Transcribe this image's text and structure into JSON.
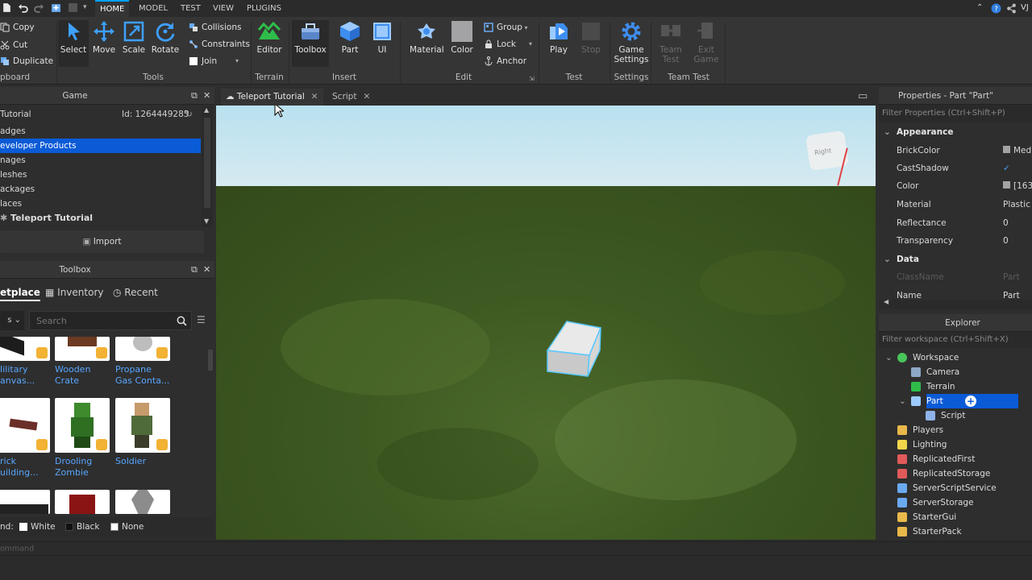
{
  "menubar": {
    "tabs": [
      "HOME",
      "MODEL",
      "TEST",
      "VIEW",
      "PLUGINS"
    ],
    "active_tab": "HOME",
    "user_initial": "VJ"
  },
  "ribbon": {
    "clipboard": {
      "copy": "Copy",
      "cut": "Cut",
      "duplicate": "Duplicate",
      "group_label": "pboard"
    },
    "tools": {
      "select": "Select",
      "move": "Move",
      "scale": "Scale",
      "rotate": "Rotate",
      "collisions": "Collisions",
      "constraints": "Constraints",
      "join": "Join",
      "group_label": "Tools"
    },
    "terrain": {
      "editor": "Editor",
      "group_label": "Terrain"
    },
    "insert": {
      "toolbox": "Toolbox",
      "part": "Part",
      "ui": "UI",
      "group_label": "Insert"
    },
    "edit": {
      "material": "Material",
      "color": "Color",
      "group": "Group",
      "lock": "Lock",
      "anchor": "Anchor",
      "group_label": "Edit"
    },
    "test": {
      "play": "Play",
      "stop": "Stop",
      "group_label": "Test"
    },
    "settings": {
      "game_settings_1": "Game",
      "game_settings_2": "Settings",
      "group_label": "Settings"
    },
    "team_test": {
      "team_test_1": "Team",
      "team_test_2": "Test",
      "exit_game_1": "Exit",
      "exit_game_2": "Game",
      "group_label": "Team Test"
    }
  },
  "game_panel": {
    "title": "Game",
    "place_name": "Tutorial",
    "place_id": "Id: 1264449285",
    "items": [
      "adges",
      "eveloper Products",
      "nages",
      "leshes",
      "ackages",
      "laces"
    ],
    "selected_index": 1,
    "place_entry": "Teleport Tutorial",
    "import_label": "Import"
  },
  "toolbox": {
    "title": "Toolbox",
    "tabs": [
      "etplace",
      "Inventory",
      "Recent"
    ],
    "search_placeholder": "Search",
    "items": [
      {
        "line1": "Iilitary",
        "line2": "anvas..."
      },
      {
        "line1": "Wooden",
        "line2": "Crate"
      },
      {
        "line1": "Propane",
        "line2": "Gas Conta..."
      },
      {
        "line1": "rick",
        "line2": "uilding..."
      },
      {
        "line1": "Drooling",
        "line2": "Zombie"
      },
      {
        "line1": "Soldier",
        "line2": ""
      }
    ],
    "bg_label": "nd:",
    "bg_options": [
      "White",
      "Black",
      "None"
    ]
  },
  "doc_tabs": [
    {
      "label": "Teleport Tutorial",
      "active": true
    },
    {
      "label": "Script",
      "active": false
    }
  ],
  "viewport": {
    "view_cube_label": "Right"
  },
  "properties": {
    "title": "Properties - Part \"Part\"",
    "filter_placeholder": "Filter Properties (Ctrl+Shift+P)",
    "sections": [
      {
        "name": "Appearance",
        "rows": [
          {
            "name": "BrickColor",
            "value": "Med"
          },
          {
            "name": "CastShadow",
            "value": "✓"
          },
          {
            "name": "Color",
            "value": "[163"
          },
          {
            "name": "Material",
            "value": "Plastic"
          },
          {
            "name": "Reflectance",
            "value": "0"
          },
          {
            "name": "Transparency",
            "value": "0"
          }
        ]
      },
      {
        "name": "Data",
        "rows": [
          {
            "name": "ClassName",
            "value": "Part"
          },
          {
            "name": "Name",
            "value": "Part"
          }
        ]
      }
    ]
  },
  "explorer": {
    "title": "Explorer",
    "filter_placeholder": "Filter workspace (Ctrl+Shift+X)",
    "items": [
      {
        "label": "Workspace",
        "icon": "globe-icon"
      },
      {
        "label": "Camera",
        "icon": "camera-icon"
      },
      {
        "label": "Terrain",
        "icon": "terrain-icon"
      },
      {
        "label": "Part",
        "icon": "part-icon"
      },
      {
        "label": "Script",
        "icon": "script-icon"
      },
      {
        "label": "Players",
        "icon": "players-icon"
      },
      {
        "label": "Lighting",
        "icon": "bulb-icon"
      },
      {
        "label": "ReplicatedFirst",
        "icon": "replicated-icon"
      },
      {
        "label": "ReplicatedStorage",
        "icon": "replicated-storage-icon"
      },
      {
        "label": "ServerScriptService",
        "icon": "server-script-icon"
      },
      {
        "label": "ServerStorage",
        "icon": "server-storage-icon"
      },
      {
        "label": "StarterGui",
        "icon": "startergui-icon"
      },
      {
        "label": "StarterPack",
        "icon": "starterpack-icon"
      }
    ]
  },
  "command_bar": {
    "placeholder": "ommand"
  },
  "colors": {
    "accent": "#00a2ff",
    "selection": "#0b5bd7",
    "panel": "#2e2e2e",
    "ribbon": "#353535"
  }
}
